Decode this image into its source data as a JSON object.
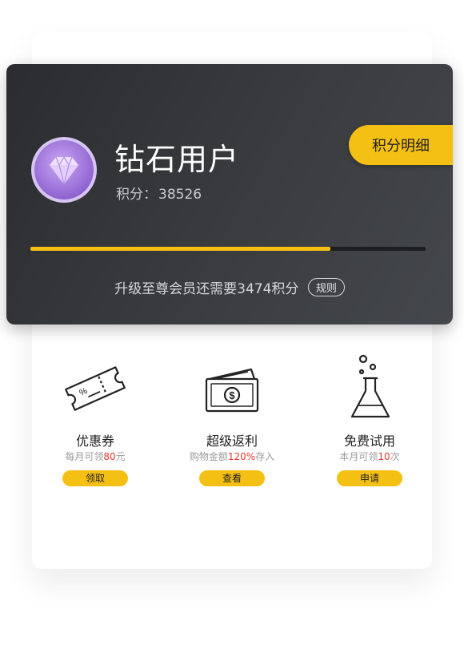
{
  "card": {
    "level_name": "钻石用户",
    "points_label": "积分：",
    "points_value": "38526",
    "points_detail_button": "积分明细",
    "progress_fraction": 0.76,
    "upgrade_text": "升级至尊会员还需要3474积分",
    "rules_label": "规则",
    "accent_color": "#f5c014"
  },
  "benefits": [
    {
      "icon": "coupon-ticket-icon",
      "title": "优惠券",
      "desc_prefix": "每月可领",
      "desc_highlight": "80",
      "desc_suffix": "元",
      "button": "领取"
    },
    {
      "icon": "cash-back-card-icon",
      "title": "超级返利",
      "desc_prefix": "购物金额",
      "desc_highlight": "120%",
      "desc_suffix": "存入",
      "button": "查看"
    },
    {
      "icon": "lab-flask-icon",
      "title": "免费试用",
      "desc_prefix": "本月可领",
      "desc_highlight": "10",
      "desc_suffix": "次",
      "button": "申请"
    }
  ]
}
